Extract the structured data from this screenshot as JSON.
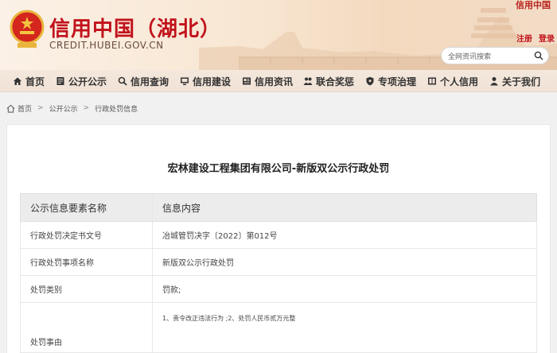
{
  "header": {
    "title": "信用中国（湖北）",
    "url": "CREDIT.HUBEI.GOV.CN",
    "brand_small": "信用中国",
    "register": "注册",
    "login": "登录",
    "search_placeholder": "全网资讯搜索"
  },
  "nav": [
    {
      "label": "首页",
      "icon": "home-icon"
    },
    {
      "label": "公开公示",
      "icon": "document-icon"
    },
    {
      "label": "信用查询",
      "icon": "search-icon"
    },
    {
      "label": "信用建设",
      "icon": "monitor-icon"
    },
    {
      "label": "信用资讯",
      "icon": "news-icon"
    },
    {
      "label": "联合奖惩",
      "icon": "people-icon"
    },
    {
      "label": "专项治理",
      "icon": "shield-icon"
    },
    {
      "label": "个人信用",
      "icon": "card-icon"
    },
    {
      "label": "关于我们",
      "icon": "user-icon"
    }
  ],
  "breadcrumb": {
    "home": "首页",
    "level1": "公开公示",
    "level2": "行政处罚信息"
  },
  "page": {
    "headline": "宏林建设工程集团有限公司-新版双公示行政处罚"
  },
  "table": {
    "header": [
      "公示信息要素名称",
      "信息内容"
    ],
    "rows": [
      {
        "label": "行政处罚决定书文号",
        "value": "冶城管罚决字〔2022〕第012号"
      },
      {
        "label": "行政处罚事项名称",
        "value": "新版双公示行政处罚"
      },
      {
        "label": "处罚类别",
        "value": "罚款;"
      },
      {
        "label": "处罚事由",
        "value": "1、责令改正违法行为 ;2、处罚人民币贰万元整"
      }
    ]
  },
  "colors": {
    "brand_red": "#c1121b",
    "nav_bg": "#f0e2d6"
  }
}
